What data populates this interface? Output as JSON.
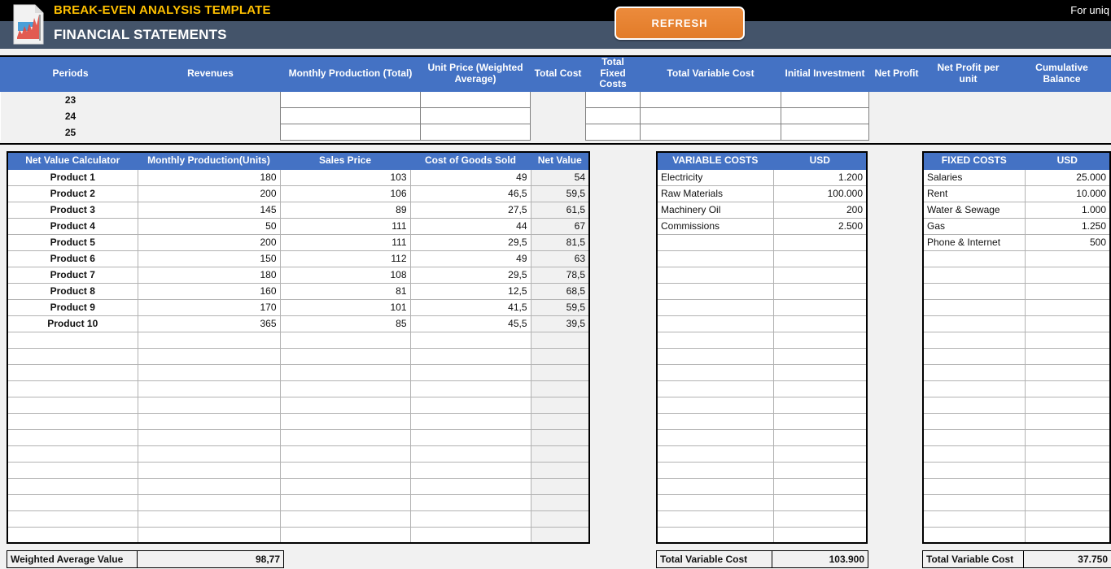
{
  "header": {
    "title": "BREAK-EVEN ANALYSIS TEMPLATE",
    "subtitle": "FINANCIAL STATEMENTS",
    "tagline": "For uniq",
    "refresh_label": "REFRESH",
    "logo_icon": "document-chart-icon",
    "accent_yellow": "#FFC000",
    "banner_dark": "#000000",
    "banner_slate": "#44546A",
    "header_blue": "#4472C4",
    "refresh_orange": "#E27B28"
  },
  "financial_table": {
    "columns": [
      "Periods",
      "Revenues",
      "Monthly Production (Total)",
      "Unit Price (Weighted Average)",
      "Total Cost",
      "Total Fixed Costs",
      "Total Variable Cost",
      "Initial Investment",
      "Net Profit",
      "Net Profit per unit",
      "Cumulative Balance"
    ],
    "rows": [
      {
        "period": "23",
        "revenues": "",
        "monthly_production": "",
        "unit_price": "",
        "total_cost": "",
        "total_fixed_costs": "",
        "total_variable_cost": "",
        "initial_investment": "",
        "net_profit": "",
        "net_profit_per_unit": "",
        "cumulative_balance": ""
      },
      {
        "period": "24",
        "revenues": "",
        "monthly_production": "",
        "unit_price": "",
        "total_cost": "",
        "total_fixed_costs": "",
        "total_variable_cost": "",
        "initial_investment": "",
        "net_profit": "",
        "net_profit_per_unit": "",
        "cumulative_balance": ""
      },
      {
        "period": "25",
        "revenues": "",
        "monthly_production": "",
        "unit_price": "",
        "total_cost": "",
        "total_fixed_costs": "",
        "total_variable_cost": "",
        "initial_investment": "",
        "net_profit": "",
        "net_profit_per_unit": "",
        "cumulative_balance": ""
      }
    ]
  },
  "net_value_calculator": {
    "columns": [
      "Net Value Calculator",
      "Monthly Production(Units)",
      "Sales Price",
      "Cost of Goods Sold",
      "Net Value"
    ],
    "rows": [
      {
        "product": "Product 1",
        "monthly_production": "180",
        "sales_price": "103",
        "cogs": "49",
        "net_value": "54"
      },
      {
        "product": "Product 2",
        "monthly_production": "200",
        "sales_price": "106",
        "cogs": "46,5",
        "net_value": "59,5"
      },
      {
        "product": "Product 3",
        "monthly_production": "145",
        "sales_price": "89",
        "cogs": "27,5",
        "net_value": "61,5"
      },
      {
        "product": "Product 4",
        "monthly_production": "50",
        "sales_price": "111",
        "cogs": "44",
        "net_value": "67"
      },
      {
        "product": "Product 5",
        "monthly_production": "200",
        "sales_price": "111",
        "cogs": "29,5",
        "net_value": "81,5"
      },
      {
        "product": "Product 6",
        "monthly_production": "150",
        "sales_price": "112",
        "cogs": "49",
        "net_value": "63"
      },
      {
        "product": "Product 7",
        "monthly_production": "180",
        "sales_price": "108",
        "cogs": "29,5",
        "net_value": "78,5"
      },
      {
        "product": "Product 8",
        "monthly_production": "160",
        "sales_price": "81",
        "cogs": "12,5",
        "net_value": "68,5"
      },
      {
        "product": "Product 9",
        "monthly_production": "170",
        "sales_price": "101",
        "cogs": "41,5",
        "net_value": "59,5"
      },
      {
        "product": "Product 10",
        "monthly_production": "365",
        "sales_price": "85",
        "cogs": "45,5",
        "net_value": "39,5"
      }
    ],
    "empty_row_count": 13,
    "footer": {
      "label": "Weighted Average Value",
      "value": "98,77"
    }
  },
  "variable_costs": {
    "columns": [
      "VARIABLE COSTS",
      "USD"
    ],
    "rows": [
      {
        "name": "Electricity",
        "amount": "1.200"
      },
      {
        "name": "Raw Materials",
        "amount": "100.000"
      },
      {
        "name": "Machinery Oil",
        "amount": "200"
      },
      {
        "name": "Commissions",
        "amount": "2.500"
      }
    ],
    "empty_row_count": 19,
    "footer": {
      "label": "Total Variable Cost",
      "value": "103.900"
    }
  },
  "fixed_costs": {
    "columns": [
      "FIXED COSTS",
      "USD"
    ],
    "rows": [
      {
        "name": "Salaries",
        "amount": "25.000"
      },
      {
        "name": "Rent",
        "amount": "10.000"
      },
      {
        "name": "Water & Sewage",
        "amount": "1.000"
      },
      {
        "name": "Gas",
        "amount": "1.250"
      },
      {
        "name": "Phone & Internet",
        "amount": "500"
      }
    ],
    "empty_row_count": 18,
    "footer": {
      "label": "Total Variable Cost",
      "value": "37.750"
    }
  }
}
